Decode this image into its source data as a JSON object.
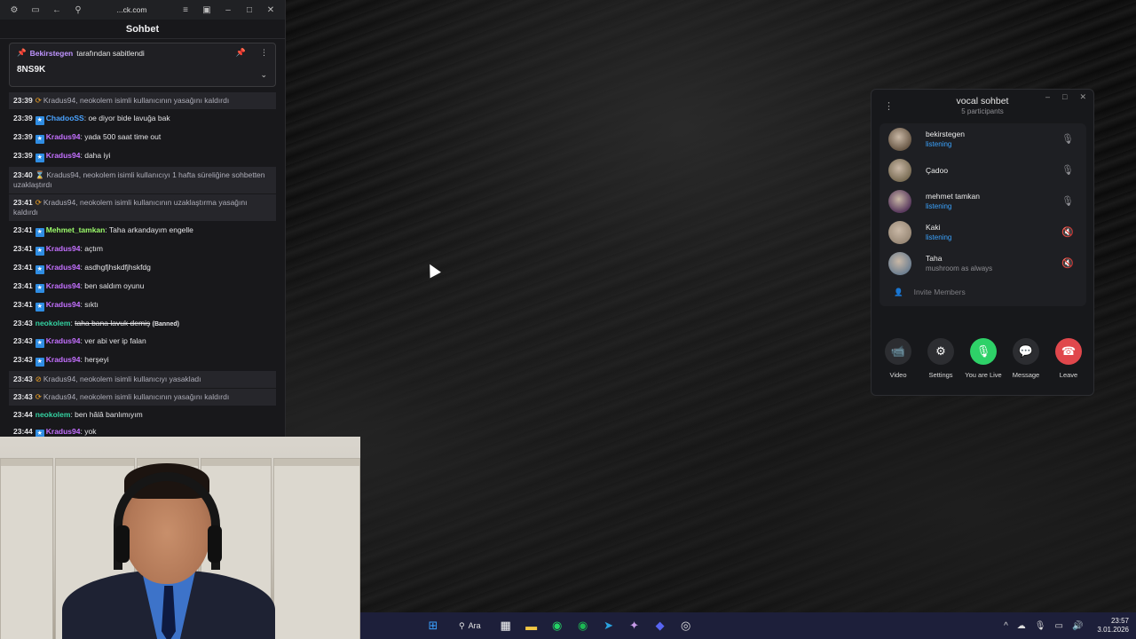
{
  "browser": {
    "url": "...ck.com",
    "icons": [
      "settings-icon",
      "sidebar-icon",
      "back-icon",
      "site-info-icon",
      "reader-icon",
      "tabs-icon",
      "minimize-icon",
      "maximize-icon",
      "close-icon"
    ]
  },
  "chat": {
    "title": "Sohbet",
    "pinned": {
      "user": "Bekirstegen",
      "by_text": "tarafından sabitlendi",
      "content": "8NS9K"
    },
    "messages": [
      {
        "time": "23:39",
        "type": "sys",
        "icon": "refresh",
        "text": "Kradus94, neokolem isimli kullanıcının yasağını kaldırdı"
      },
      {
        "time": "23:39",
        "type": "msg",
        "badge": true,
        "user": "ChadooSS",
        "color": "u-blue",
        "text": ": oe diyor bide lavuğa bak"
      },
      {
        "time": "23:39",
        "type": "msg",
        "badge": true,
        "user": "Kradus94",
        "color": "u-purple",
        "text": ": yada 500 saat time out"
      },
      {
        "time": "23:39",
        "type": "msg",
        "badge": true,
        "user": "Kradus94",
        "color": "u-purple",
        "text": ": daha iyi"
      },
      {
        "time": "23:40",
        "type": "sys",
        "icon": "hourglass",
        "text": "Kradus94, neokolem isimli kullanıcıyı 1 hafta süreliğine sohbetten uzaklaştırdı"
      },
      {
        "time": "23:41",
        "type": "sys",
        "icon": "refresh",
        "text": "Kradus94, neokolem isimli kullanıcının uzaklaştırma yasağını kaldırdı"
      },
      {
        "time": "23:41",
        "type": "msg",
        "badge": true,
        "user": "Mehmet_tamkan",
        "color": "u-green",
        "text": ": Taha arkandayım engelle"
      },
      {
        "time": "23:41",
        "type": "msg",
        "badge": true,
        "user": "Kradus94",
        "color": "u-purple",
        "text": ": açtım"
      },
      {
        "time": "23:41",
        "type": "msg",
        "badge": true,
        "user": "Kradus94",
        "color": "u-purple",
        "text": ": asdhgfjhskdfjhskfdg"
      },
      {
        "time": "23:41",
        "type": "msg",
        "badge": true,
        "user": "Kradus94",
        "color": "u-purple",
        "text": ": ben saldım oyunu"
      },
      {
        "time": "23:41",
        "type": "msg",
        "badge": true,
        "user": "Kradus94",
        "color": "u-purple",
        "text": ": sıktı"
      },
      {
        "time": "23:43",
        "type": "banned",
        "badge": false,
        "user": "neokolem",
        "color": "u-teal",
        "text": "taha bana lavuk demiş",
        "suffix": "(Banned)"
      },
      {
        "time": "23:43",
        "type": "msg",
        "badge": true,
        "user": "Kradus94",
        "color": "u-purple",
        "text": ": ver abi ver ip falan"
      },
      {
        "time": "23:43",
        "type": "msg",
        "badge": true,
        "user": "Kradus94",
        "color": "u-purple",
        "text": ": herşeyi"
      },
      {
        "time": "23:43",
        "type": "sys",
        "icon": "ban",
        "text": "Kradus94, neokolem isimli kullanıcıyı yasakladı"
      },
      {
        "time": "23:43",
        "type": "sys",
        "icon": "refresh",
        "text": "Kradus94, neokolem isimli kullanıcının yasağını kaldırdı"
      },
      {
        "time": "23:44",
        "type": "msg",
        "badge": false,
        "user": "neokolem",
        "color": "u-teal",
        "text": ": ben hâlâ banlımıyım"
      },
      {
        "time": "23:44",
        "type": "msg",
        "badge": true,
        "user": "Kradus94",
        "color": "u-purple",
        "text": ": yok"
      }
    ]
  },
  "voice": {
    "title": "vocal sohbet",
    "subtitle": "5 participants",
    "participants": [
      {
        "name": "bekirstegen",
        "status": "listening",
        "status_grey": false,
        "mic": "mic",
        "avatar": "#6b5a48"
      },
      {
        "name": "Çadoo",
        "status": "",
        "status_grey": false,
        "mic": "mic",
        "avatar": "#7a6d55"
      },
      {
        "name": "mehmet tamkan",
        "status": "listening",
        "status_grey": false,
        "mic": "mic",
        "avatar": "#5a3a5e"
      },
      {
        "name": "Kaki",
        "status": "listening",
        "status_grey": false,
        "mic": "mic-off",
        "avatar": "#9a8a78"
      },
      {
        "name": "Taha",
        "status": "mushroom as always",
        "status_grey": true,
        "mic": "mic-off",
        "avatar": "#6f8091"
      }
    ],
    "invite_label": "Invite Members",
    "actions": [
      {
        "label": "Video",
        "icon": "📹",
        "style": ""
      },
      {
        "label": "Settings",
        "icon": "⚙",
        "style": ""
      },
      {
        "label": "You are Live",
        "icon": "🎙",
        "style": "live"
      },
      {
        "label": "Message",
        "icon": "💬",
        "style": ""
      },
      {
        "label": "Leave",
        "icon": "☎",
        "style": "leave"
      }
    ]
  },
  "taskbar": {
    "search_label": "Ara",
    "apps": [
      "start-icon",
      "search-icon",
      "widgets-icon",
      "file-explorer-icon",
      "whatsapp-icon",
      "spotify-icon",
      "telegram-icon",
      "app-icon",
      "discord-icon",
      "chrome-icon"
    ],
    "time": "23:57",
    "date": "3.01.2026"
  }
}
